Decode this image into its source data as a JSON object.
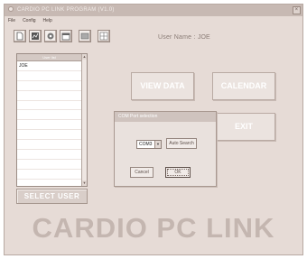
{
  "window": {
    "title": "CARDIO PC LINK PROGRAM (V1.0)",
    "close_glyph": "×"
  },
  "menu": {
    "items": [
      "File",
      "Config",
      "Help"
    ]
  },
  "toolbar": {
    "buttons": [
      {
        "icon": "new-file-icon"
      },
      {
        "icon": "chart-icon"
      },
      {
        "icon": "settings-icon"
      },
      {
        "icon": "calendar-icon"
      },
      {
        "icon": "monitor-icon"
      },
      {
        "icon": "grid-icon"
      }
    ],
    "user_label": "User Name :",
    "user_value": "JOE"
  },
  "user_list": {
    "header": "User list",
    "rows": [
      "JOE",
      "",
      "",
      "",
      "",
      "",
      "",
      "",
      "",
      "",
      "",
      "",
      ""
    ],
    "scroll_up": "▲",
    "scroll_down": "▼"
  },
  "select_user_label": "SELECT USER",
  "buttons": {
    "view_data": "VIEW DATA",
    "calendar": "CALENDAR",
    "exit": "EXIT"
  },
  "dialog": {
    "title": "COM Port selection",
    "com_value": "COM3",
    "dropdown_glyph": "▼",
    "auto_search": "Auto Search",
    "cancel": "Cancel",
    "ok": "OK"
  },
  "banner": "CARDIO PC LINK",
  "colors": {
    "window_bg": "#e6dbd6",
    "banner_text": "#c4b6b0",
    "button_text": "#ffffff"
  }
}
